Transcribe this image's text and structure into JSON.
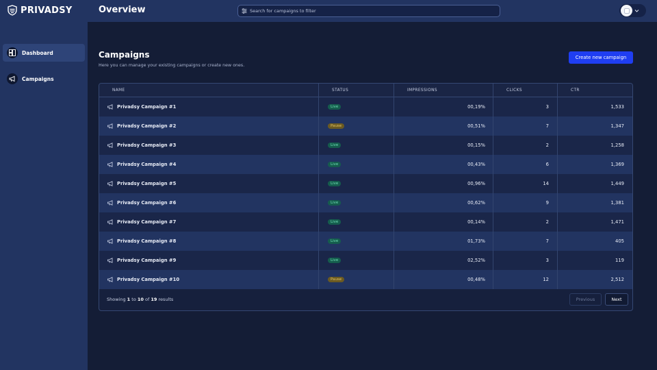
{
  "app": {
    "name": "PRIVADSY"
  },
  "sidebar": {
    "items": [
      {
        "label": "Dashboard",
        "icon": "dashboard-icon",
        "active": true
      },
      {
        "label": "Campaigns",
        "icon": "megaphone-icon",
        "active": false
      }
    ]
  },
  "header": {
    "title": "Overview",
    "search_placeholder": "Search for campaigns to filter"
  },
  "section": {
    "title": "Campaigns",
    "subtitle": "Here you can manage your existing campaigns or create new ones.",
    "create_label": "Create new campaign"
  },
  "table": {
    "columns": [
      "NAME",
      "STATUS",
      "IMPRESSIONS",
      "CLICKS",
      "CTR"
    ],
    "rows": [
      {
        "name": "Privadsy Campaign #1",
        "status": "Live",
        "impressions": "00,19%",
        "clicks": "3",
        "ctr": "1,533"
      },
      {
        "name": "Privadsy Campaign #2",
        "status": "Pause",
        "impressions": "00,51%",
        "clicks": "7",
        "ctr": "1,347"
      },
      {
        "name": "Privadsy Campaign #3",
        "status": "Live",
        "impressions": "00,15%",
        "clicks": "2",
        "ctr": "1,258"
      },
      {
        "name": "Privadsy Campaign #4",
        "status": "Live",
        "impressions": "00,43%",
        "clicks": "6",
        "ctr": "1,369"
      },
      {
        "name": "Privadsy Campaign #5",
        "status": "Live",
        "impressions": "00,96%",
        "clicks": "14",
        "ctr": "1,449"
      },
      {
        "name": "Privadsy Campaign #6",
        "status": "Live",
        "impressions": "00,62%",
        "clicks": "9",
        "ctr": "1,381"
      },
      {
        "name": "Privadsy Campaign #7",
        "status": "Live",
        "impressions": "00,14%",
        "clicks": "2",
        "ctr": "1,471"
      },
      {
        "name": "Privadsy Campaign #8",
        "status": "Live",
        "impressions": "01,73%",
        "clicks": "7",
        "ctr": "405"
      },
      {
        "name": "Privadsy Campaign #9",
        "status": "Live",
        "impressions": "02,52%",
        "clicks": "3",
        "ctr": "119"
      },
      {
        "name": "Privadsy Campaign #10",
        "status": "Pause",
        "impressions": "00,48%",
        "clicks": "12",
        "ctr": "2,512"
      }
    ]
  },
  "pagination": {
    "showing_prefix": "Showing",
    "from": "1",
    "to_word": "to",
    "to": "10",
    "of_word": "of",
    "total": "19",
    "results_word": "results",
    "prev_label": "Previous",
    "next_label": "Next"
  },
  "colors": {
    "background": "#141d36",
    "sidebar": "#223461",
    "accent": "#1f3ef2",
    "live": "#155d4d",
    "pause": "#6b5a22"
  }
}
